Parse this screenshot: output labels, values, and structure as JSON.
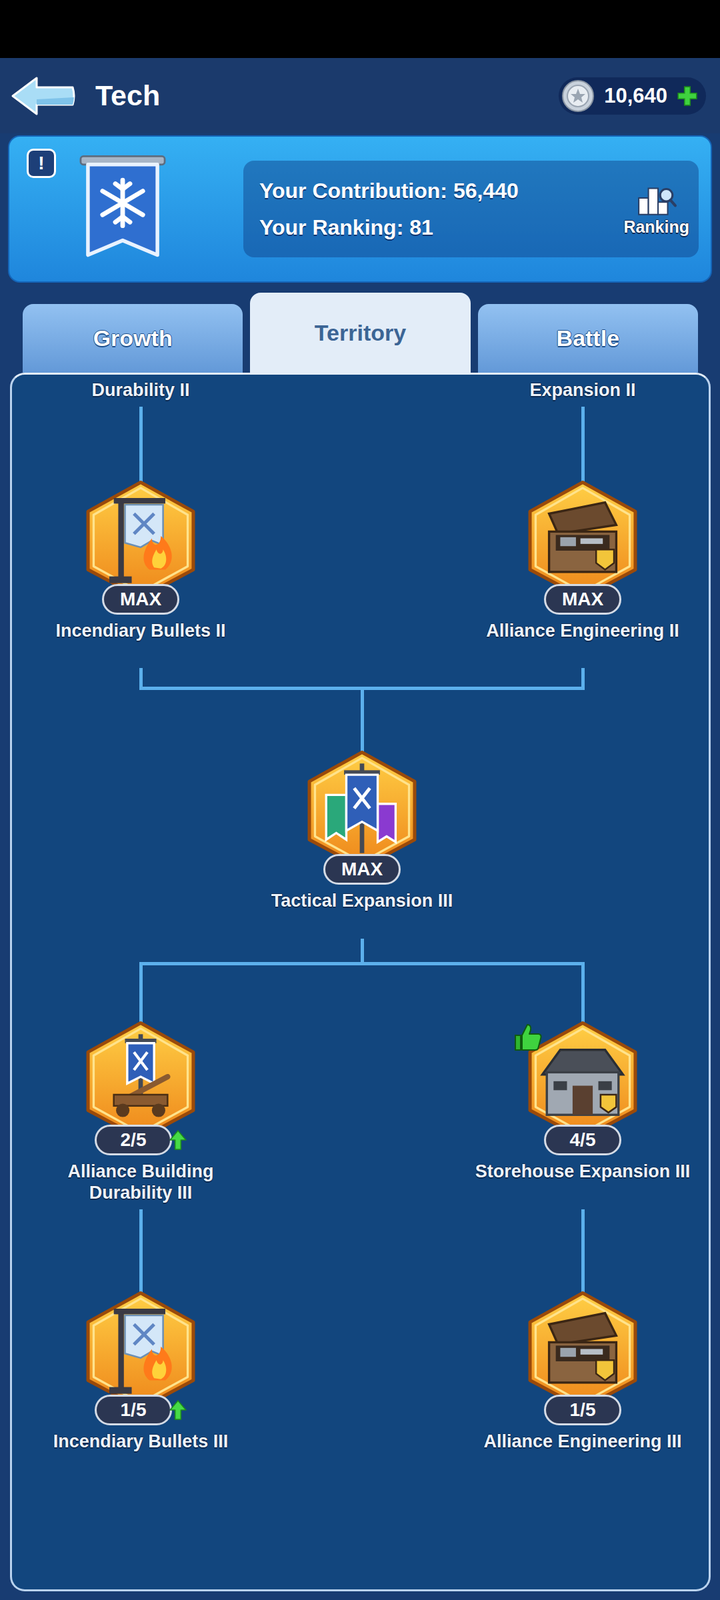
{
  "header": {
    "title": "Tech",
    "coins": "10,640"
  },
  "banner": {
    "alert": "!",
    "contribution": "Your Contribution: 56,440",
    "ranking": "Your Ranking: 81",
    "ranking_button": "Ranking"
  },
  "tabs": [
    {
      "label": "Growth",
      "selected": false
    },
    {
      "label": "Territory",
      "selected": true
    },
    {
      "label": "Battle",
      "selected": false
    }
  ],
  "tree": {
    "cut_labels": [
      "Durability II",
      "Expansion II"
    ],
    "nodes": [
      {
        "name": "Incendiary Bullets II",
        "level": "MAX",
        "upgradable": false,
        "recommended": false
      },
      {
        "name": "Alliance Engineering II",
        "level": "MAX",
        "upgradable": false,
        "recommended": false
      },
      {
        "name": "Tactical Expansion III",
        "level": "MAX",
        "upgradable": false,
        "recommended": false
      },
      {
        "name": "Alliance Building Durability III",
        "level": "2/5",
        "upgradable": true,
        "recommended": false
      },
      {
        "name": "Storehouse Expansion III",
        "level": "4/5",
        "upgradable": false,
        "recommended": true
      },
      {
        "name": "Incendiary Bullets III",
        "level": "1/5",
        "upgradable": true,
        "recommended": false
      },
      {
        "name": "Alliance Engineering III",
        "level": "1/5",
        "upgradable": false,
        "recommended": false
      }
    ]
  }
}
